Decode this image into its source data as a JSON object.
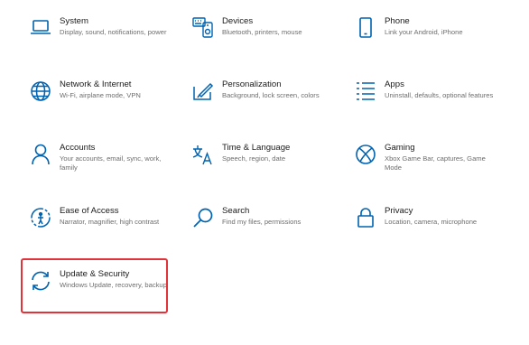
{
  "accent": "#0063b1",
  "highlight_color": "#e2323a",
  "tiles": [
    {
      "title": "System",
      "desc": "Display, sound, notifications, power",
      "icon": "laptop-icon"
    },
    {
      "title": "Devices",
      "desc": "Bluetooth, printers, mouse",
      "icon": "keyboard-devices-icon"
    },
    {
      "title": "Phone",
      "desc": "Link your Android, iPhone",
      "icon": "phone-icon"
    },
    {
      "title": "Network & Internet",
      "desc": "Wi-Fi, airplane mode, VPN",
      "icon": "globe-icon"
    },
    {
      "title": "Personalization",
      "desc": "Background, lock screen, colors",
      "icon": "paint-brush-icon"
    },
    {
      "title": "Apps",
      "desc": "Uninstall, defaults, optional features",
      "icon": "apps-list-icon"
    },
    {
      "title": "Accounts",
      "desc": "Your accounts, email, sync, work, family",
      "icon": "person-icon"
    },
    {
      "title": "Time & Language",
      "desc": "Speech, region, date",
      "icon": "time-language-icon"
    },
    {
      "title": "Gaming",
      "desc": "Xbox Game Bar, captures, Game Mode",
      "icon": "xbox-icon"
    },
    {
      "title": "Ease of Access",
      "desc": "Narrator, magnifier, high contrast",
      "icon": "ease-of-access-icon"
    },
    {
      "title": "Search",
      "desc": "Find my files, permissions",
      "icon": "search-icon"
    },
    {
      "title": "Privacy",
      "desc": "Location, camera, microphone",
      "icon": "lock-icon"
    },
    {
      "title": "Update & Security",
      "desc": "Windows Update, recovery, backup",
      "icon": "sync-icon"
    }
  ]
}
